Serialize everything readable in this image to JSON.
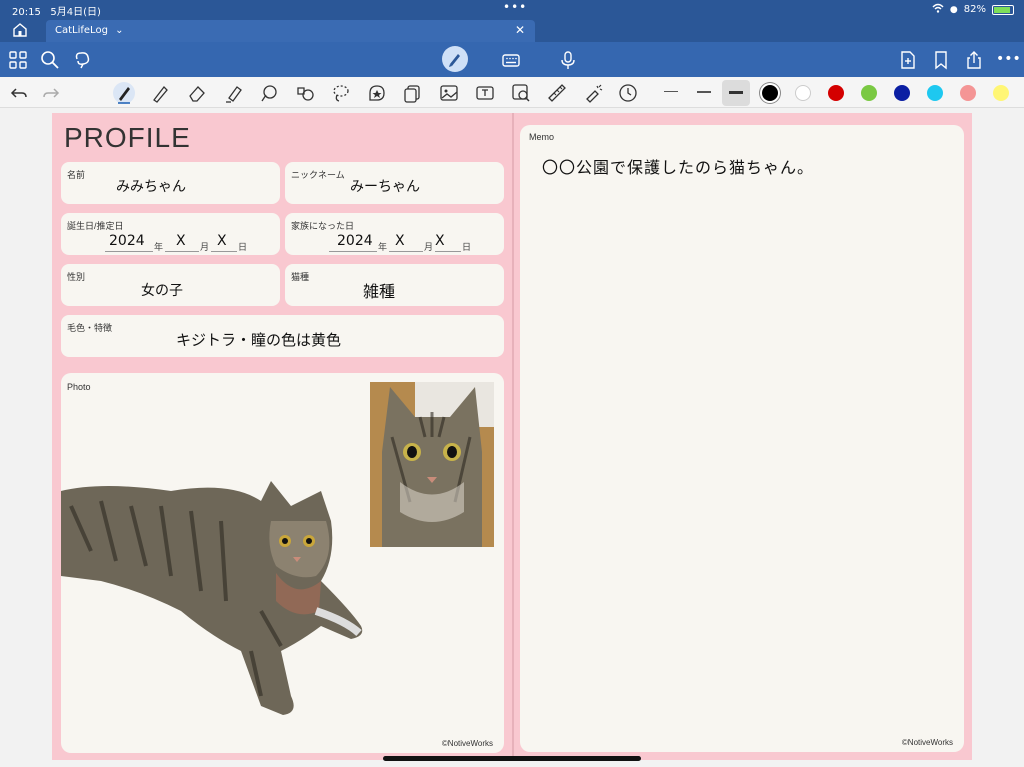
{
  "status_bar": {
    "time": "20:15",
    "date": "5月4日(日)",
    "battery": "82%",
    "dots": "•••"
  },
  "tabbar": {
    "tab_title": "CatLifeLog",
    "tab_chevron": "⌄",
    "close": "✕"
  },
  "toolbar": {
    "left_icons": [
      "grid-icon",
      "search-icon",
      "lasso-hand-icon"
    ],
    "center_icons": [
      "pen-mode-icon",
      "keyboard-icon",
      "microphone-icon"
    ],
    "right_icons": [
      "add-page-icon",
      "bookmark-icon",
      "share-icon",
      "more-icon"
    ],
    "more": "•••"
  },
  "drawbar": {
    "tools": [
      "undo-icon",
      "redo-icon",
      "pen-icon",
      "pencil-icon",
      "eraser-icon",
      "highlighter-icon",
      "shape-icon",
      "shapes-fill-icon",
      "lasso-icon",
      "sticker-icon",
      "copy-icon",
      "image-icon",
      "textbox-icon",
      "image-search-icon",
      "ruler-icon",
      "laser-icon",
      "clock-icon"
    ],
    "colors": [
      "#000000",
      "#ffffff",
      "#d40000",
      "#7ac943",
      "#0b1fa3",
      "#1ec8f0",
      "#f49595",
      "#fff675"
    ],
    "selected_color": "#000000"
  },
  "profile": {
    "title": "PROFILE",
    "name": {
      "label": "名前",
      "value": "みみちゃん"
    },
    "nickname": {
      "label": "ニックネーム",
      "value": "みーちゃん"
    },
    "birthday": {
      "label": "誕生日/推定日",
      "year": "2024",
      "month": "X",
      "day": "X",
      "u_year": "年",
      "u_month": "月",
      "u_day": "日"
    },
    "family_day": {
      "label": "家族になった日",
      "year": "2024",
      "month": "X",
      "day": "X",
      "u_year": "年",
      "u_month": "月",
      "u_day": "日"
    },
    "sex": {
      "label": "性別",
      "value": "女の子"
    },
    "breed": {
      "label": "猫種",
      "value": "雑種"
    },
    "coat": {
      "label": "毛色・特徴",
      "value": "キジトラ・瞳の色は黄色"
    },
    "photo_label": "Photo",
    "copyright": "©NotiveWorks"
  },
  "memo": {
    "label": "Memo",
    "text": "〇〇公園で保護したのら猫ちゃん。",
    "copyright": "©NotiveWorks"
  }
}
